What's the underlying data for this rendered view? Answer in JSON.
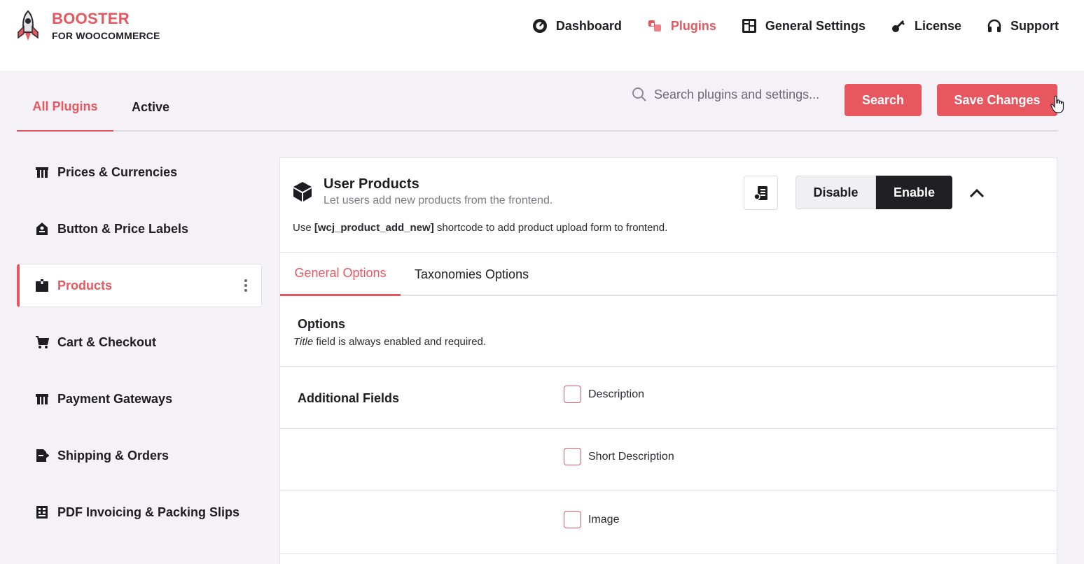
{
  "brand": {
    "title": "BOOSTER",
    "subtitle": "FOR WOOCOMMERCE",
    "accent": "#e8575f"
  },
  "topnav": [
    {
      "label": "Dashboard",
      "icon": "dashboard-icon",
      "active": false
    },
    {
      "label": "Plugins",
      "icon": "plugins-icon",
      "active": true
    },
    {
      "label": "General Settings",
      "icon": "settings-grid-icon",
      "active": false
    },
    {
      "label": "License",
      "icon": "key-icon",
      "active": false
    },
    {
      "label": "Support",
      "icon": "headphones-icon",
      "active": false
    }
  ],
  "plugin_tabs": {
    "all": "All Plugins",
    "active": "Active"
  },
  "search": {
    "placeholder": "Search plugins and settings...",
    "button": "Search"
  },
  "save_button": "Save Changes",
  "sidebar": {
    "items": [
      {
        "label": "Prices & Currencies",
        "icon": "price-tag-icon"
      },
      {
        "label": "Button & Price Labels",
        "icon": "label-icon"
      },
      {
        "label": "Products",
        "icon": "box-icon",
        "active": true
      },
      {
        "label": "Cart & Checkout",
        "icon": "cart-icon"
      },
      {
        "label": "Payment Gateways",
        "icon": "payment-icon"
      },
      {
        "label": "Shipping & Orders",
        "icon": "shipping-icon"
      },
      {
        "label": "PDF Invoicing & Packing Slips",
        "icon": "invoice-icon"
      }
    ]
  },
  "module": {
    "title": "User Products",
    "description": "Let users add new products from the frontend.",
    "note_prefix": "Use",
    "note_code": "[wcj_product_add_new]",
    "note_suffix": "shortcode to add product upload form to frontend.",
    "disable_label": "Disable",
    "enable_label": "Enable",
    "enabled": true
  },
  "module_tabs": {
    "general": "General Options",
    "taxonomies": "Taxonomies Options"
  },
  "options": {
    "title": "Options",
    "sub_italic": "Title",
    "sub_rest": "field is always enabled and required."
  },
  "additional_fields": {
    "label": "Additional Fields",
    "fields": [
      {
        "label": "Description",
        "checked": false
      },
      {
        "label": "Short Description",
        "checked": false
      },
      {
        "label": "Image",
        "checked": false
      }
    ]
  }
}
